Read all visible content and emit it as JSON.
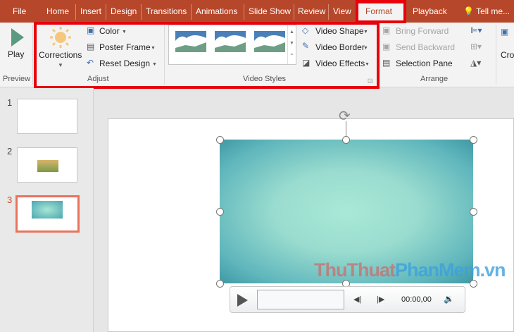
{
  "tabs": [
    {
      "label": "File"
    },
    {
      "label": "Home"
    },
    {
      "label": "Insert"
    },
    {
      "label": "Design"
    },
    {
      "label": "Transitions"
    },
    {
      "label": "Animations"
    },
    {
      "label": "Slide Show"
    },
    {
      "label": "Review"
    },
    {
      "label": "View"
    },
    {
      "label": "Format"
    },
    {
      "label": "Playback"
    },
    {
      "label": "Tell me..."
    }
  ],
  "ribbon": {
    "preview": {
      "play": "Play",
      "group": "Preview"
    },
    "adjust": {
      "corrections": "Corrections",
      "color": "Color",
      "poster_frame": "Poster Frame",
      "reset_design": "Reset Design",
      "group": "Adjust"
    },
    "video_styles": {
      "shape": "Video Shape",
      "border": "Video Border",
      "effects": "Video Effects",
      "group": "Video Styles"
    },
    "arrange": {
      "bring_forward": "Bring Forward",
      "send_backward": "Send Backward",
      "selection_pane": "Selection Pane",
      "group": "Arrange"
    },
    "crop": "Cro"
  },
  "slides": [
    {
      "number": "1"
    },
    {
      "number": "2"
    },
    {
      "number": "3"
    }
  ],
  "player": {
    "time": "00:00,00"
  },
  "watermark": {
    "part1": "ThuThuat",
    "part2": "PhanMem",
    "part3": ".vn"
  },
  "colors": {
    "accent": "#b7472a",
    "highlight": "#e8000b"
  }
}
